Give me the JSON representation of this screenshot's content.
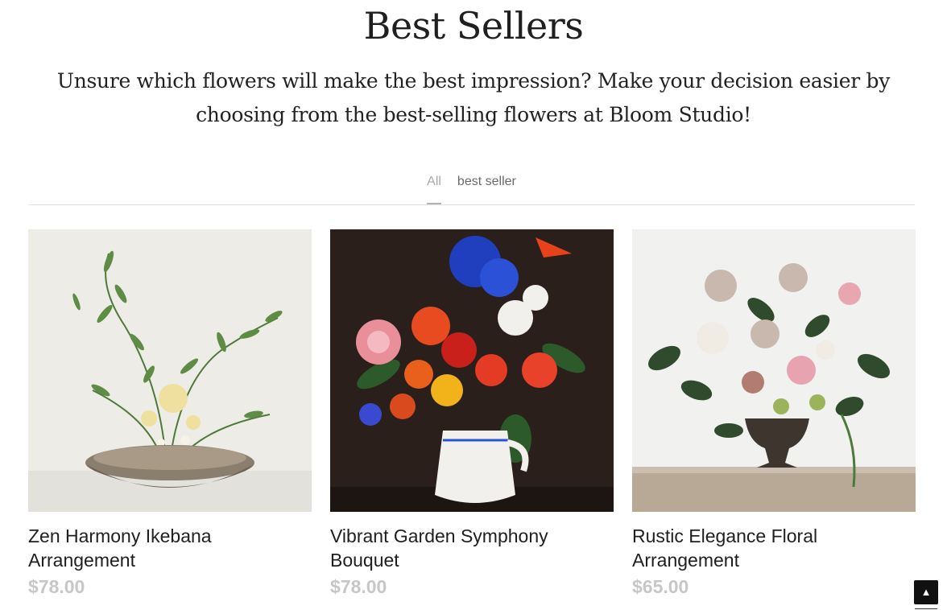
{
  "section": {
    "title": "Best Sellers",
    "subtitle": "Unsure which flowers will make the best impression? Make your decision easier by choosing from the best-selling flowers at Bloom Studio!"
  },
  "tabs": [
    {
      "label": "All",
      "active": true
    },
    {
      "label": "best seller",
      "active": false
    }
  ],
  "products": [
    {
      "name": "Zen Harmony Ikebana Arrangement",
      "price": "$78.00"
    },
    {
      "name": "Vibrant Garden Symphony Bouquet",
      "price": "$78.00"
    },
    {
      "name": "Rustic Elegance Floral Arrangement",
      "price": "$65.00"
    }
  ],
  "scroll_top": {
    "icon": "caret-up-icon",
    "glyph": "▲"
  },
  "colors": {
    "price": "#c7c7c7",
    "tab_active": "#a9a9a9",
    "text": "#1f1f1f"
  }
}
